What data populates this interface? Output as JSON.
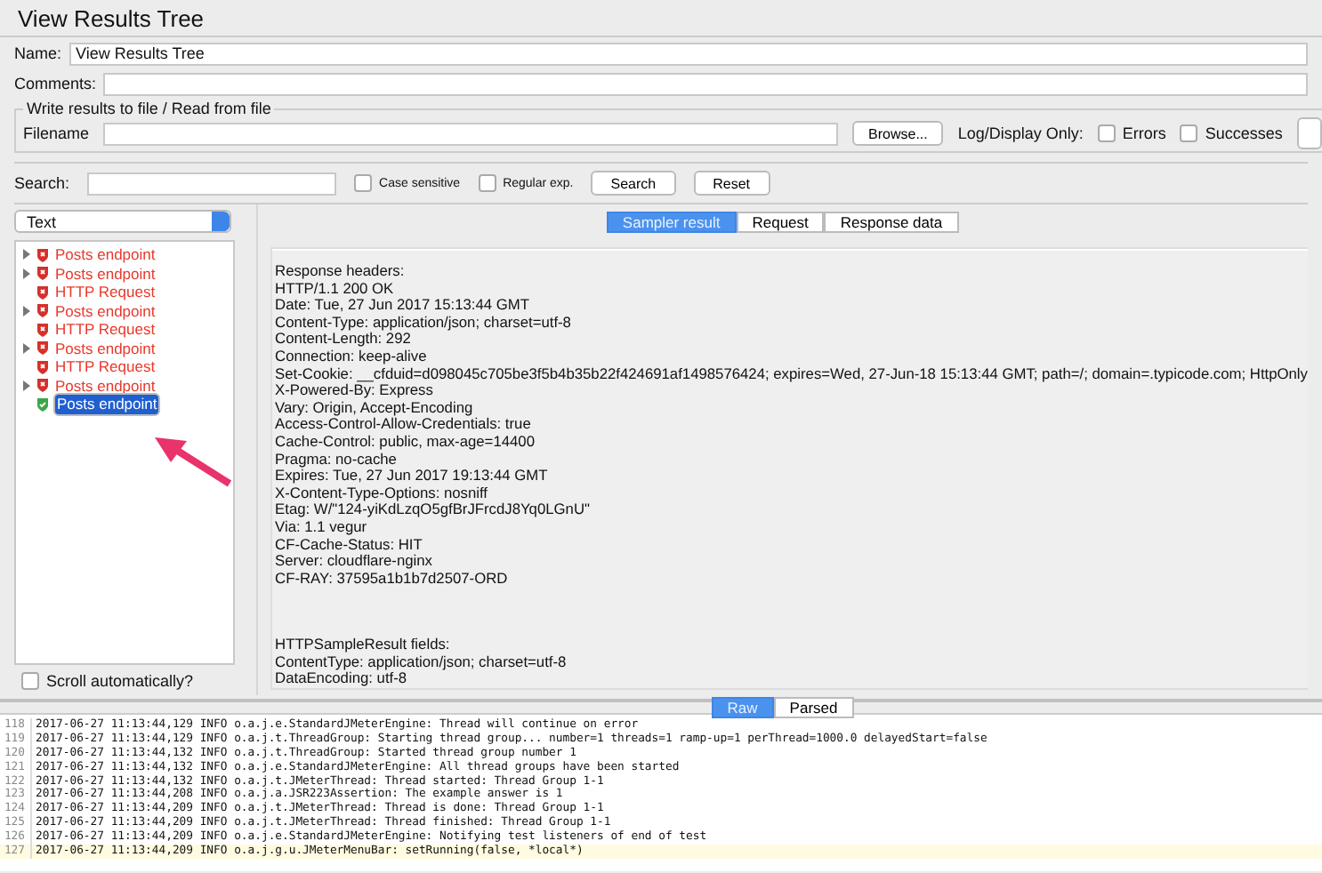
{
  "window": {
    "title": "View Results Tree"
  },
  "name_field": {
    "label": "Name:",
    "value": "View Results Tree"
  },
  "comments_field": {
    "label": "Comments:"
  },
  "file_group": {
    "legend": "Write results to file / Read from file",
    "filename_label": "Filename",
    "browse_button": "Browse...",
    "log_display_label": "Log/Display Only:",
    "checkboxes": [
      {
        "label": "Errors",
        "checked": false
      },
      {
        "label": "Successes",
        "checked": false
      }
    ]
  },
  "search_bar": {
    "label": "Search:",
    "options": [
      {
        "label": "Case sensitive",
        "checked": false
      },
      {
        "label": "Regular exp.",
        "checked": false
      }
    ],
    "buttons": [
      "Search",
      "Reset"
    ]
  },
  "renderer_select": {
    "value": "Text"
  },
  "tree": [
    {
      "label": "Posts endpoint",
      "failed": true,
      "expandable": true,
      "selected": false
    },
    {
      "label": "Posts endpoint",
      "failed": true,
      "expandable": true,
      "selected": false
    },
    {
      "label": "HTTP Request",
      "failed": true,
      "expandable": false,
      "selected": false
    },
    {
      "label": "Posts endpoint",
      "failed": true,
      "expandable": true,
      "selected": false
    },
    {
      "label": "HTTP Request",
      "failed": true,
      "expandable": false,
      "selected": false
    },
    {
      "label": "Posts endpoint",
      "failed": true,
      "expandable": true,
      "selected": false
    },
    {
      "label": "HTTP Request",
      "failed": true,
      "expandable": false,
      "selected": false
    },
    {
      "label": "Posts endpoint",
      "failed": true,
      "expandable": true,
      "selected": false
    },
    {
      "label": "Posts endpoint",
      "failed": false,
      "expandable": false,
      "selected": true
    }
  ],
  "scroll_checkbox": {
    "label": "Scroll automatically?",
    "checked": false
  },
  "result_tabs": [
    {
      "label": "Sampler result",
      "selected": true
    },
    {
      "label": "Request",
      "selected": false
    },
    {
      "label": "Response data",
      "selected": false
    }
  ],
  "result_sections": [
    {
      "lines": [
        "Response headers:",
        "HTTP/1.1 200 OK",
        "Date: Tue, 27 Jun 2017 15:13:44 GMT",
        "Content-Type: application/json; charset=utf-8",
        "Content-Length: 292",
        "Connection: keep-alive",
        "Set-Cookie: __cfduid=d098045c705be3f5b4b35b22f424691af1498576424; expires=Wed, 27-Jun-18 15:13:44 GMT; path=/; domain=.typicode.com; HttpOnly",
        "X-Powered-By: Express",
        "Vary: Origin, Accept-Encoding",
        "Access-Control-Allow-Credentials: true",
        "Cache-Control: public, max-age=14400",
        "Pragma: no-cache",
        "Expires: Tue, 27 Jun 2017 19:13:44 GMT",
        "X-Content-Type-Options: nosniff",
        "Etag: W/\"124-yiKdLzqO5gfBrJFrcdJ8Yq0LGnU\"",
        "Via: 1.1 vegur",
        "CF-Cache-Status: HIT",
        "Server: cloudflare-nginx",
        "CF-RAY: 37595a1b1b7d2507-ORD"
      ]
    },
    {
      "lines": [
        "HTTPSampleResult fields:",
        "ContentType: application/json; charset=utf-8",
        "DataEncoding: utf-8"
      ]
    }
  ],
  "view_toggle": [
    {
      "label": "Raw",
      "selected": true
    },
    {
      "label": "Parsed",
      "selected": false
    }
  ],
  "log": [
    {
      "line": "118",
      "text": "2017-06-27 11:13:44,129 INFO o.a.j.e.StandardJMeterEngine: Thread will continue on error",
      "selected": false
    },
    {
      "line": "119",
      "text": "2017-06-27 11:13:44,129 INFO o.a.j.t.ThreadGroup: Starting thread group... number=1 threads=1 ramp-up=1 perThread=1000.0 delayedStart=false",
      "selected": false
    },
    {
      "line": "120",
      "text": "2017-06-27 11:13:44,132 INFO o.a.j.t.ThreadGroup: Started thread group number 1",
      "selected": false
    },
    {
      "line": "121",
      "text": "2017-06-27 11:13:44,132 INFO o.a.j.e.StandardJMeterEngine: All thread groups have been started",
      "selected": false
    },
    {
      "line": "122",
      "text": "2017-06-27 11:13:44,132 INFO o.a.j.t.JMeterThread: Thread started: Thread Group 1-1",
      "selected": false
    },
    {
      "line": "123",
      "text": "2017-06-27 11:13:44,208 INFO o.a.j.a.JSR223Assertion: The example answer is 1",
      "selected": false
    },
    {
      "line": "124",
      "text": "2017-06-27 11:13:44,209 INFO o.a.j.t.JMeterThread: Thread is done: Thread Group 1-1",
      "selected": false
    },
    {
      "line": "125",
      "text": "2017-06-27 11:13:44,209 INFO o.a.j.t.JMeterThread: Thread finished: Thread Group 1-1",
      "selected": false
    },
    {
      "line": "126",
      "text": "2017-06-27 11:13:44,209 INFO o.a.j.e.StandardJMeterEngine: Notifying test listeners of end of test",
      "selected": false
    },
    {
      "line": "127",
      "text": "2017-06-27 11:13:44,209 INFO o.a.j.g.u.JMeterMenuBar: setRunning(false, *local*)",
      "selected": true
    }
  ]
}
